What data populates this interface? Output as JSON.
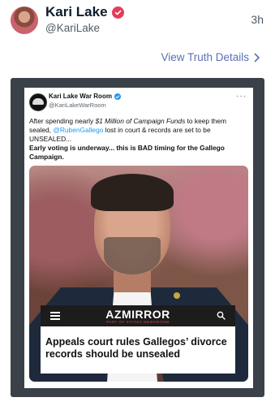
{
  "post": {
    "author_name": "Kari Lake",
    "author_handle": "@KariLake",
    "time": "3h",
    "view_details": "View Truth Details"
  },
  "embedded_tweet": {
    "account_name": "Kari Lake War Room",
    "account_handle": "@KariLakeWarRoom",
    "more": "···",
    "text_before": "After spending nearly ",
    "text_emphasis": "$1 Million of Campaign Funds",
    "text_after": " to keep them sealed,",
    "mention": "@RubenGallego",
    "text_after_mention": " lost in court & records are set to be UNSEALED...",
    "text_bold": "Early voting is underway... this is BAD timing for the Gallego Campaign."
  },
  "news_overlay": {
    "logo": "AZMIRROR",
    "logo_sub": "PART OF STATES NEWSROOM",
    "headline": "Appeals court rules Gallegos’ divorce records should be unsealed"
  },
  "colors": {
    "verified_badge": "#e23d5c",
    "link": "#5a6fb8",
    "mention": "#1d9bf0"
  }
}
